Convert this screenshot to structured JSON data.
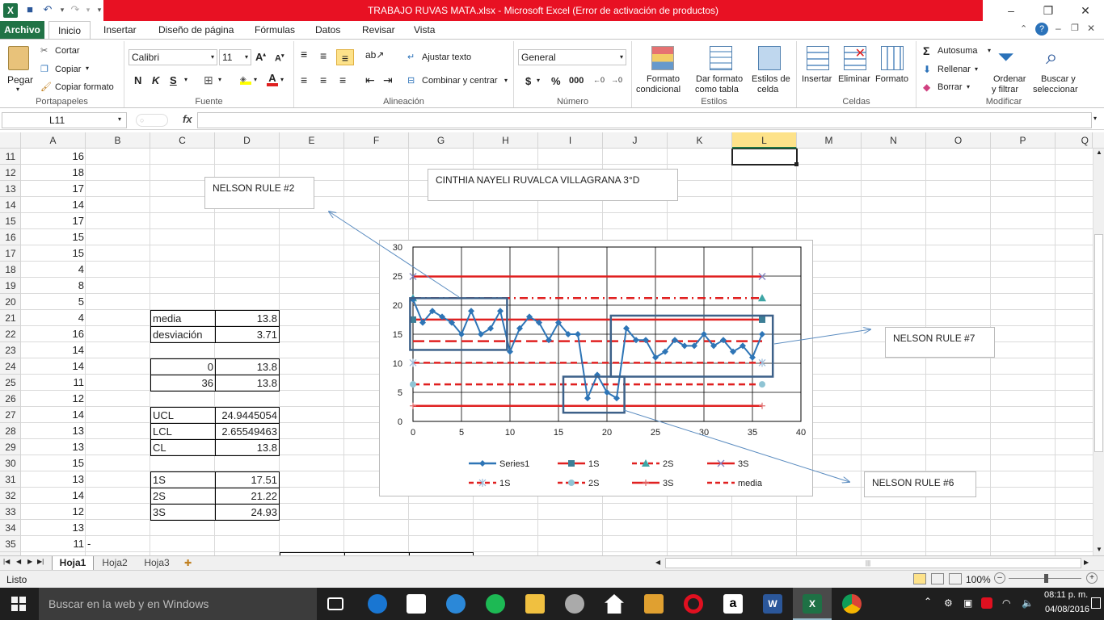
{
  "window": {
    "title": "TRABAJO RUVAS MATA.xlsx  -  Microsoft Excel (Error de activación de productos)",
    "controls": [
      "?",
      "–",
      "❐",
      "✕"
    ]
  },
  "tabs": [
    "Archivo",
    "Inicio",
    "Insertar",
    "Diseño de página",
    "Fórmulas",
    "Datos",
    "Revisar",
    "Vista"
  ],
  "ribbon": {
    "portapapeles": {
      "label": "Portapapeles",
      "pegar": "Pegar",
      "cortar": "Cortar",
      "copiar": "Copiar",
      "copiar_formato": "Copiar formato"
    },
    "fuente": {
      "label": "Fuente",
      "font": "Calibri",
      "size": "11",
      "bold": "N",
      "italic": "K",
      "underline": "S"
    },
    "alineacion": {
      "label": "Alineación",
      "ajustar": "Ajustar texto",
      "combinar": "Combinar y centrar"
    },
    "numero": {
      "label": "Número",
      "format": "General",
      "currency": "$",
      "percent": "%",
      "thousands": "000"
    },
    "estilos": {
      "label": "Estilos",
      "formato_cond_1": "Formato",
      "formato_cond_2": "condicional",
      "dar_formato_1": "Dar formato",
      "dar_formato_2": "como tabla",
      "estilos_celda_1": "Estilos de",
      "estilos_celda_2": "celda"
    },
    "celdas": {
      "label": "Celdas",
      "insertar": "Insertar",
      "eliminar": "Eliminar",
      "formato": "Formato"
    },
    "modificar": {
      "label": "Modificar",
      "autosuma": "Autosuma",
      "rellenar": "Rellenar",
      "borrar": "Borrar",
      "ordenar_1": "Ordenar",
      "ordenar_2": "y filtrar",
      "buscar_1": "Buscar y",
      "buscar_2": "seleccionar"
    }
  },
  "formula_bar": {
    "name_box": "L11",
    "fx": "fx",
    "value": ""
  },
  "columns": [
    "A",
    "B",
    "C",
    "D",
    "E",
    "F",
    "G",
    "H",
    "I",
    "J",
    "K",
    "L",
    "M",
    "N",
    "O",
    "P",
    "Q"
  ],
  "rows": [
    "11",
    "12",
    "13",
    "14",
    "15",
    "16",
    "17",
    "18",
    "19",
    "20",
    "21",
    "22",
    "23",
    "24",
    "25",
    "26",
    "27",
    "28",
    "29",
    "30",
    "31",
    "32",
    "33",
    "34",
    "35"
  ],
  "col_a": [
    "16",
    "18",
    "17",
    "14",
    "17",
    "15",
    "15",
    "4",
    "8",
    "5",
    "4",
    "16",
    "14",
    "14",
    "11",
    "12",
    "14",
    "13",
    "13",
    "15",
    "13",
    "14",
    "12",
    "13",
    "11"
  ],
  "b35": "-",
  "cells": {
    "c21": "media",
    "d21": "13.8",
    "c22": "desviación",
    "d22": "3.71",
    "c24": "0",
    "d24": "13.8",
    "c25": "36",
    "d25": "13.8",
    "c27": "UCL",
    "d27": "24.9445054",
    "c28": "LCL",
    "d28": "2.65549463",
    "c29": "CL",
    "d29": "13.8",
    "c31": "1S",
    "d31": "17.51",
    "c32": "2S",
    "d32": "21.22",
    "c33": "3S",
    "d33": "24.93"
  },
  "textboxes": {
    "name": "CINTHIA NAYELI RUVALCA  VILLAGRANA 3°D",
    "rule2": "NELSON RULE #2",
    "rule7": "NELSON RULE #7",
    "rule6": "NELSON RULE #6"
  },
  "chart_data": {
    "type": "line",
    "xlim": [
      0,
      40
    ],
    "ylim": [
      0,
      30
    ],
    "x_ticks": [
      "0",
      "5",
      "10",
      "15",
      "20",
      "25",
      "30",
      "35",
      "40"
    ],
    "y_ticks": [
      "0",
      "5",
      "10",
      "15",
      "20",
      "25",
      "30"
    ],
    "grid": true,
    "legend_position": "bottom",
    "series": [
      {
        "name": "Series1",
        "color": "#2e75b6",
        "marker": "diamond",
        "x": [
          0,
          1,
          2,
          3,
          4,
          5,
          6,
          7,
          8,
          9,
          10,
          11,
          12,
          13,
          14,
          15,
          16,
          17,
          18,
          19,
          20,
          21,
          22,
          23,
          24,
          25,
          26,
          27,
          28,
          29,
          30,
          31,
          32,
          33,
          34,
          35,
          36
        ],
        "y": [
          21,
          17,
          19,
          18,
          17,
          15,
          19,
          15,
          16,
          19,
          12,
          16,
          18,
          17,
          14,
          17,
          15,
          15,
          4,
          8,
          5,
          4,
          16,
          14,
          14,
          11,
          12,
          14,
          13,
          13,
          15,
          13,
          14,
          12,
          13,
          11,
          15
        ]
      },
      {
        "name": "1S",
        "color": "#e02020",
        "style": "solid",
        "marker": "square",
        "marker_color": "#3c7e96",
        "y": 17.51
      },
      {
        "name": "2S",
        "color": "#e02020",
        "style": "dashdot",
        "marker": "triangle",
        "marker_color": "#3ea5a5",
        "y": 21.22
      },
      {
        "name": "3S",
        "color": "#e02020",
        "style": "solid",
        "marker": "x",
        "marker_color": "#8080c0",
        "y": 24.93
      },
      {
        "name": "1S",
        "color": "#e02020",
        "style": "dashed",
        "marker": "star",
        "marker_color": "#9bbbd9",
        "y": 10.09
      },
      {
        "name": "2S",
        "color": "#e02020",
        "style": "dashed",
        "marker": "circle",
        "marker_color": "#8fc4d4",
        "y": 6.38
      },
      {
        "name": "3S",
        "color": "#e02020",
        "style": "solid",
        "marker": "plus",
        "marker_color": "#e07070",
        "y": 2.67
      },
      {
        "name": "media",
        "color": "#e02020",
        "style": "longdash",
        "y": 13.8
      }
    ]
  },
  "sheets": [
    "Hoja1",
    "Hoja2",
    "Hoja3"
  ],
  "status": {
    "text": "Listo",
    "zoom": "100%"
  },
  "taskbar": {
    "search": "Buscar en la web y en Windows",
    "time": "08:11 p. m.",
    "date": "04/08/2016"
  }
}
